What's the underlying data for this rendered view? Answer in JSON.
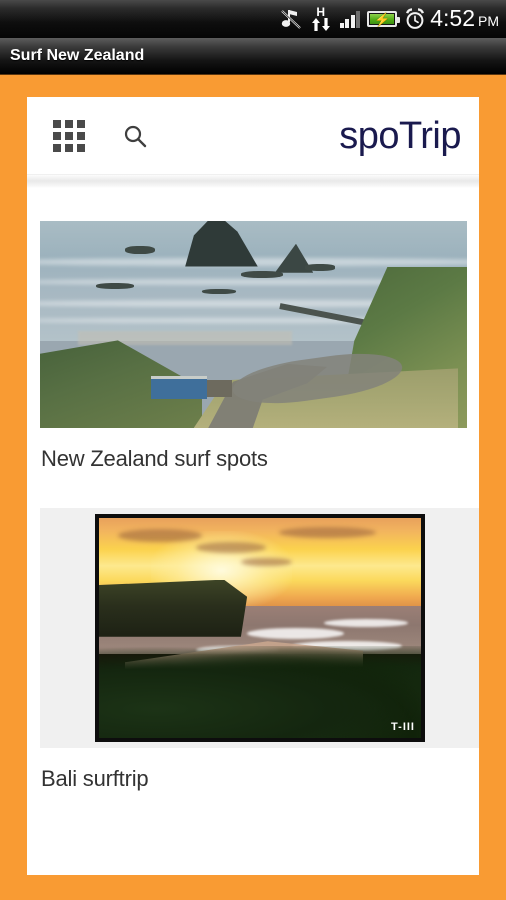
{
  "status_bar": {
    "icons": [
      {
        "name": "music-note-icon",
        "label": "music"
      },
      {
        "name": "hspa-data-icon",
        "label": "H"
      },
      {
        "name": "signal-bars-icon",
        "label": "signal",
        "bars_lit": 3,
        "bars_total": 4
      },
      {
        "name": "battery-charging-icon",
        "label": "battery charging",
        "bolt": "⚡"
      },
      {
        "name": "alarm-clock-icon",
        "label": "alarm"
      }
    ],
    "hspa_letter": "H",
    "time": "4:52",
    "ampm": "PM"
  },
  "title_bar": {
    "text": "Surf New Zealand"
  },
  "app_header": {
    "grid_icon": "grid-menu-icon",
    "search_icon": "search-icon",
    "brand": "spoTrip"
  },
  "theme": {
    "page_background": "#f99b33",
    "panel_background": "#ffffff",
    "brand_color": "#1a1a4e",
    "card_title_color": "#333333",
    "thumb_panel_background": "#f0f0f0",
    "status_bar_background": "#0a0a0a",
    "title_bar_text_color": "#ffffff"
  },
  "feed": {
    "cards": [
      {
        "title": "New Zealand surf spots",
        "image_name": "new-zealand-coast-photo",
        "image_alt": "Aerial view of a New Zealand surf beach with rocky headlands, a winding road and a blue building",
        "has_frame": false
      },
      {
        "title": "Bali surftrip",
        "image_name": "bali-sunset-surf-photo",
        "image_alt": "Golden sunset over a Bali point break with cliff, breaking waves and dark foliage in the foreground",
        "has_frame": true,
        "watermark": "T-III"
      }
    ]
  }
}
